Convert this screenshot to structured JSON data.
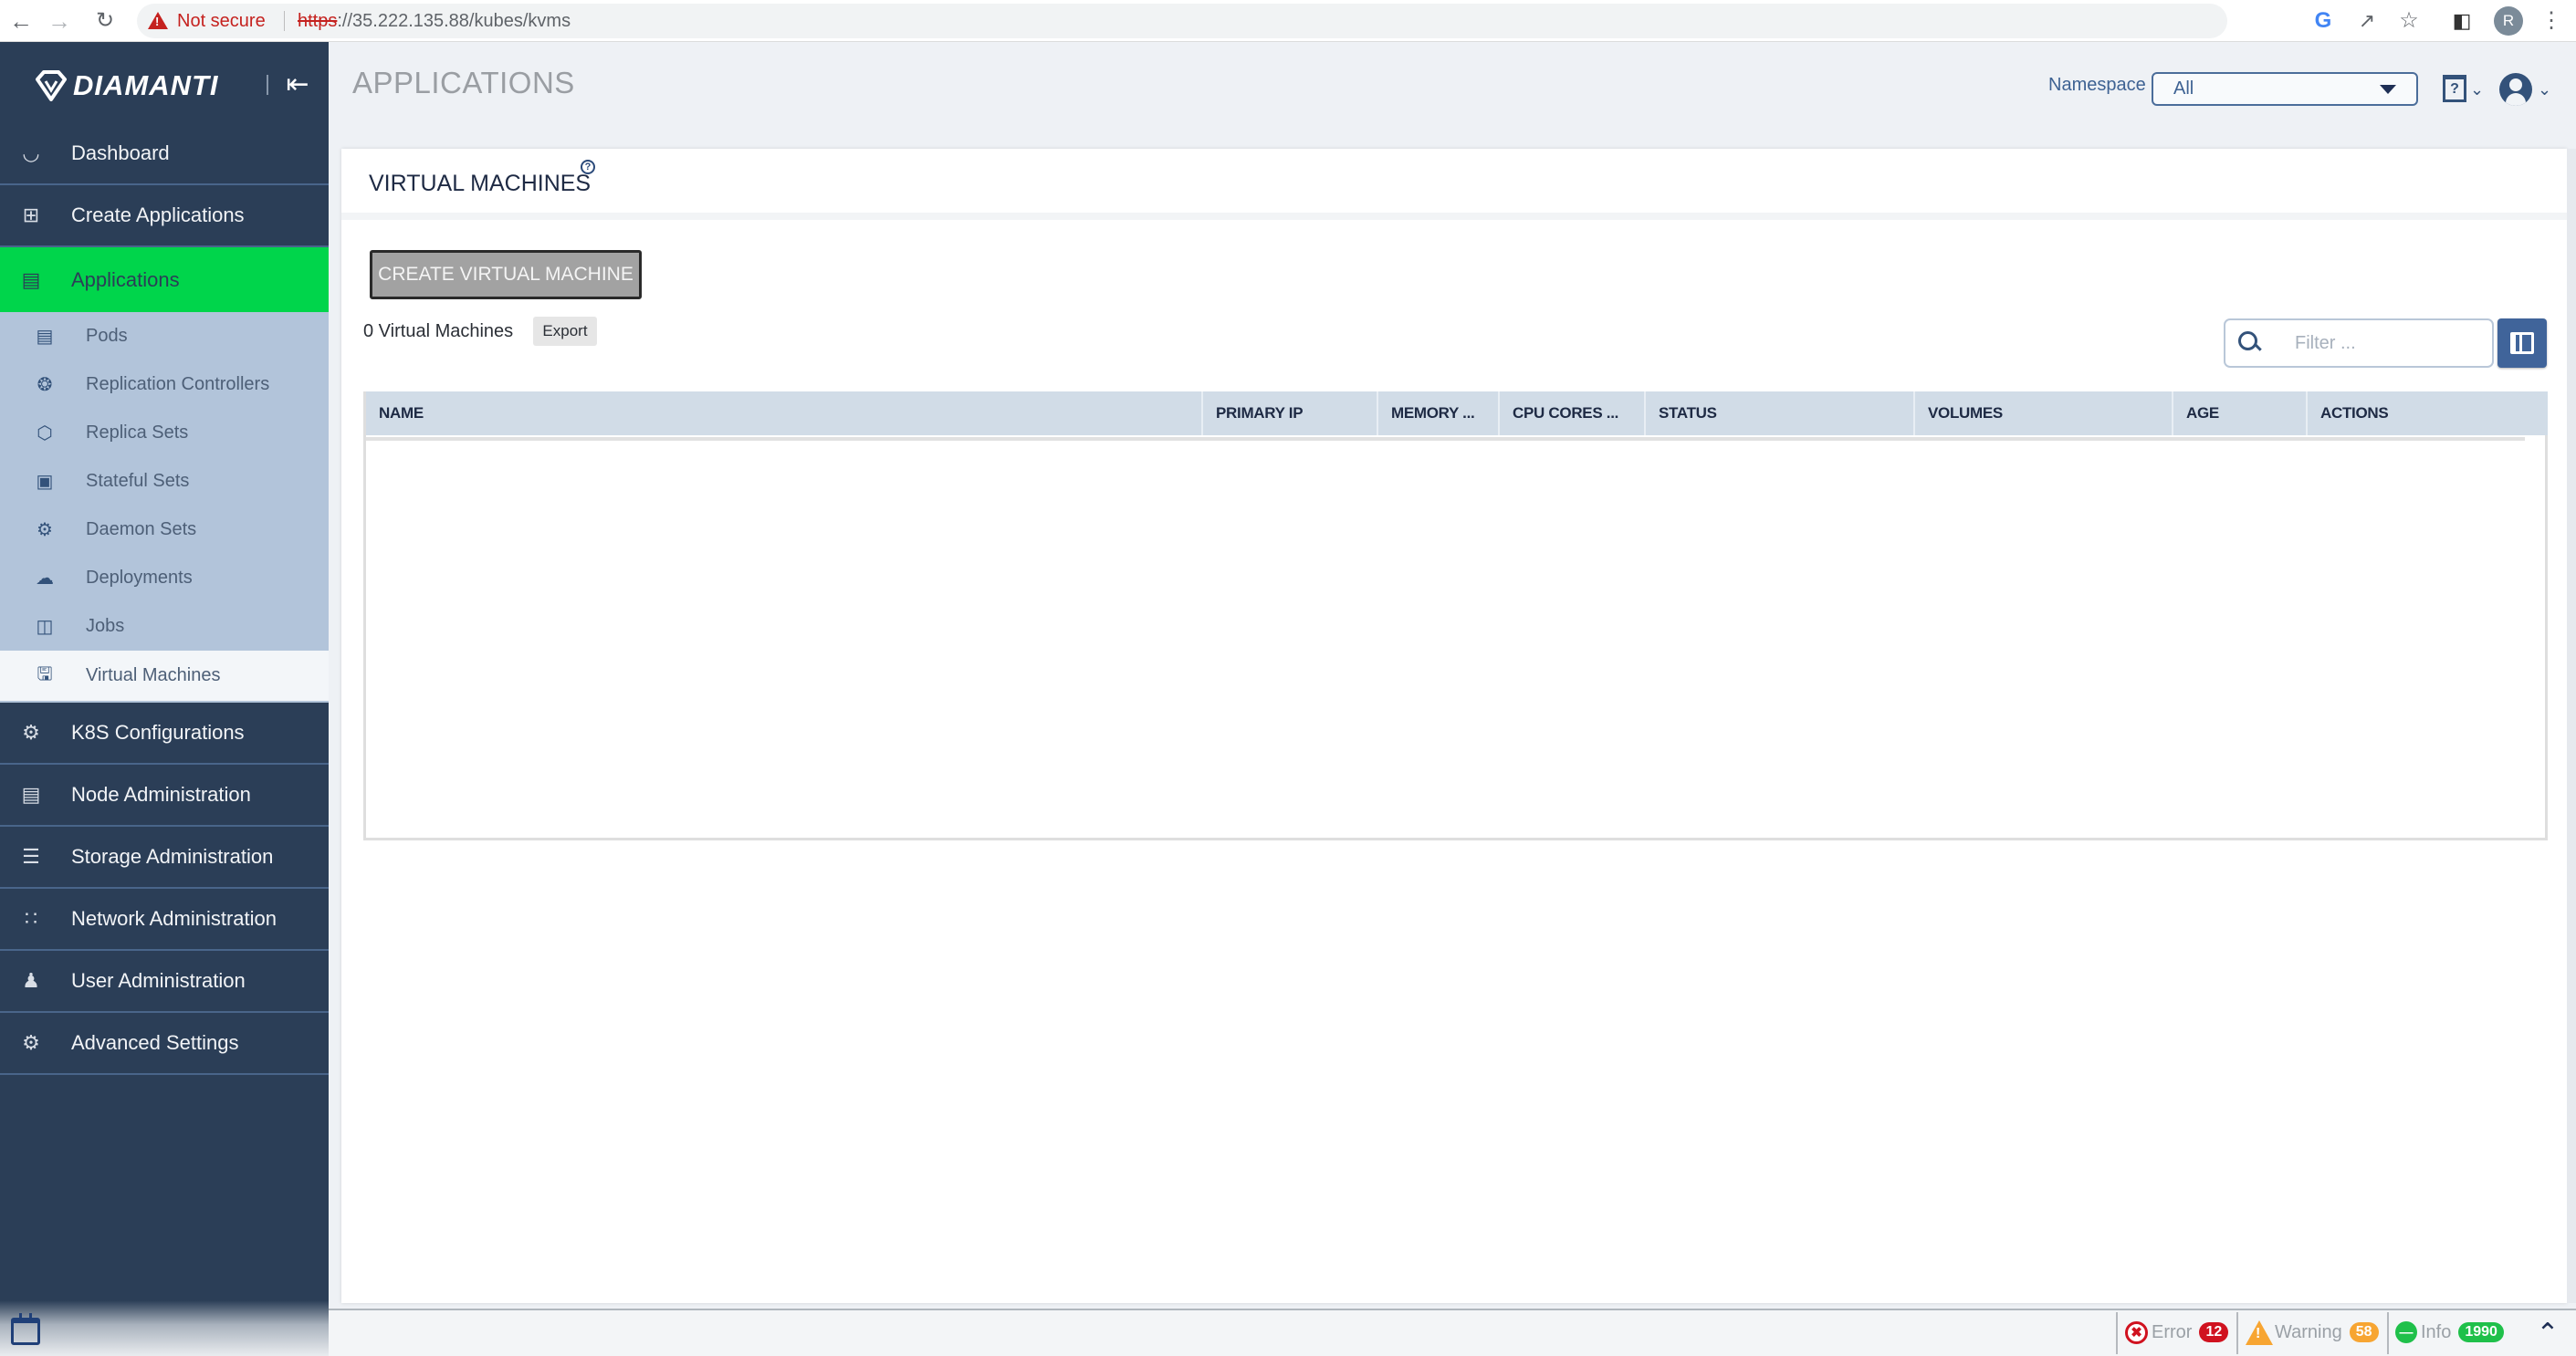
{
  "browser": {
    "not_secure_label": "Not secure",
    "url_scheme": "https",
    "url_rest": "://35.222.135.88/kubes/kvms",
    "profile_initial": "R",
    "icons": [
      "back-icon",
      "forward-icon",
      "reload-icon",
      "warning-icon",
      "google-icon",
      "share-icon",
      "bookmark-star-icon",
      "side-panel-icon",
      "profile-avatar",
      "more-vert-icon"
    ]
  },
  "sidebar": {
    "brand": "DIAMANTI",
    "top_items": [
      {
        "label": "Dashboard",
        "icon": "dashboard-gauge-icon"
      },
      {
        "label": "Create Applications",
        "icon": "plus-square-icon"
      },
      {
        "label": "Applications",
        "icon": "list-icon",
        "active": true
      }
    ],
    "sub_items": [
      {
        "label": "Pods",
        "icon": "pods-icon"
      },
      {
        "label": "Replication Controllers",
        "icon": "replication-controllers-icon"
      },
      {
        "label": "Replica Sets",
        "icon": "replica-sets-icon"
      },
      {
        "label": "Stateful Sets",
        "icon": "stateful-sets-icon"
      },
      {
        "label": "Daemon Sets",
        "icon": "daemon-sets-icon"
      },
      {
        "label": "Deployments",
        "icon": "deployments-icon"
      },
      {
        "label": "Jobs",
        "icon": "jobs-icon"
      },
      {
        "label": "Virtual Machines",
        "icon": "virtual-machines-icon",
        "current": true
      }
    ],
    "bottom_items": [
      {
        "label": "K8S Configurations",
        "icon": "k8s-gear-icon"
      },
      {
        "label": "Node Administration",
        "icon": "server-node-icon"
      },
      {
        "label": "Storage Administration",
        "icon": "database-icon"
      },
      {
        "label": "Network Administration",
        "icon": "network-tree-icon"
      },
      {
        "label": "User Administration",
        "icon": "users-icon"
      },
      {
        "label": "Advanced Settings",
        "icon": "gears-icon"
      }
    ]
  },
  "header": {
    "title": "APPLICATIONS",
    "namespace_label": "Namespace",
    "namespace_value": "All",
    "help_icon": "?"
  },
  "panel": {
    "title": "VIRTUAL MACHINES",
    "help_glyph": "?",
    "create_button": "CREATE VIRTUAL MACHINE",
    "count_text": "0 Virtual Machines",
    "export_button": "Export",
    "filter_placeholder": "Filter ...",
    "table": {
      "columns": [
        "NAME",
        "PRIMARY IP",
        "MEMORY ...",
        "CPU CORES ...",
        "STATUS",
        "VOLUMES",
        "AGE",
        "ACTIONS"
      ],
      "rows": []
    }
  },
  "status_bar": {
    "error_label": "Error",
    "error_count": "12",
    "warning_label": "Warning",
    "warning_count": "58",
    "info_label": "Info",
    "info_count": "1990"
  },
  "colors": {
    "sidebar_bg": "#2b3e57",
    "active_green": "#00d54b",
    "submenu_bg": "#b2c4da",
    "accent_blue": "#40649a",
    "error_red": "#d0121f",
    "warning_orange": "#f7a532",
    "info_green": "#1fc04a"
  }
}
